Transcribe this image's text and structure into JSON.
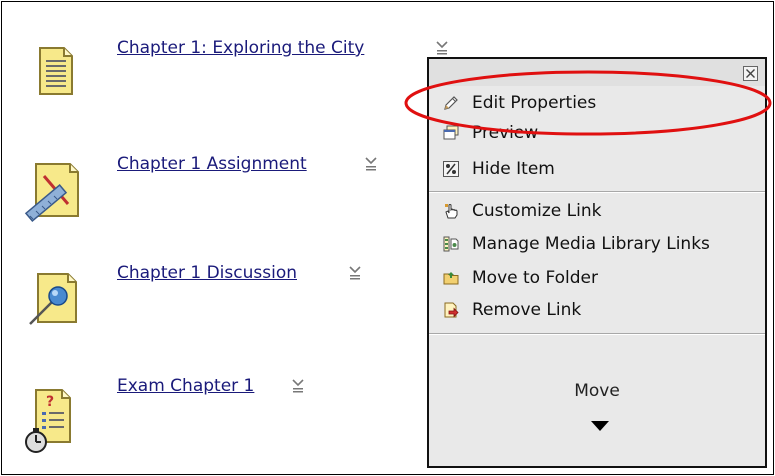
{
  "items": [
    {
      "label": "Chapter 1: Exploring the City",
      "icon": "document-icon"
    },
    {
      "label": "Chapter 1 Assignment",
      "icon": "assignment-icon"
    },
    {
      "label": "Chapter 1 Discussion",
      "icon": "discussion-icon"
    },
    {
      "label": "Exam Chapter 1",
      "icon": "exam-icon"
    }
  ],
  "context_menu": {
    "close_icon": "close-icon",
    "items": [
      {
        "label": "Edit Properties",
        "icon": "pencil-icon"
      },
      {
        "label": "Preview",
        "icon": "preview-icon"
      },
      {
        "label": "Hide Item",
        "icon": "hide-item-icon"
      },
      {
        "label": "Customize Link",
        "icon": "hand-pointer-icon"
      },
      {
        "label": "Manage Media Library Links",
        "icon": "media-library-icon"
      },
      {
        "label": "Move to Folder",
        "icon": "folder-icon"
      },
      {
        "label": "Remove Link",
        "icon": "remove-link-icon"
      }
    ],
    "move_label": "Move"
  },
  "colors": {
    "link": "#1a1a7a",
    "highlight": "#e01010",
    "menu_bg": "#e9e9e9"
  }
}
